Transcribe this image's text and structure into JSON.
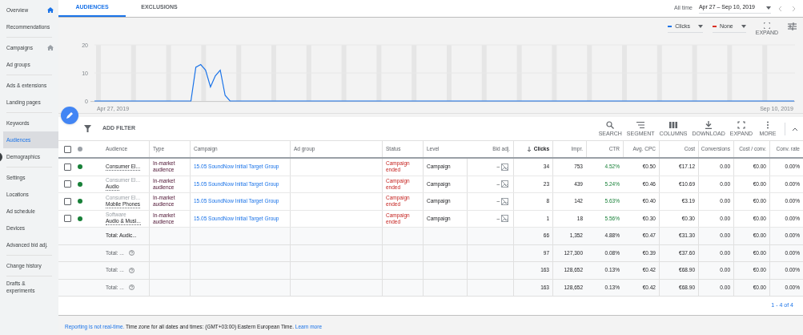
{
  "sidebar": {
    "sections": [
      [
        {
          "label": "Overview",
          "home": true,
          "selected": false
        },
        {
          "label": "Recommendations",
          "home": false,
          "selected": false
        }
      ],
      [
        {
          "label": "Campaigns",
          "home": true,
          "selected": false
        },
        {
          "label": "Ad groups",
          "home": false,
          "selected": false
        }
      ],
      [
        {
          "label": "Ads & extensions",
          "home": false,
          "selected": false
        },
        {
          "label": "Landing pages",
          "home": false,
          "selected": false
        }
      ],
      [
        {
          "label": "Keywords",
          "home": false,
          "selected": false
        },
        {
          "label": "Audiences",
          "home": false,
          "selected": true
        },
        {
          "label": "Demographics",
          "home": false,
          "selected": false
        }
      ],
      [
        {
          "label": "Settings",
          "home": false,
          "selected": false
        },
        {
          "label": "Locations",
          "home": false,
          "selected": false
        },
        {
          "label": "Ad schedule",
          "home": false,
          "selected": false
        },
        {
          "label": "Devices",
          "home": false,
          "selected": false
        },
        {
          "label": "Advanced bid adj.",
          "home": false,
          "selected": false
        }
      ],
      [
        {
          "label": "Change history",
          "home": false,
          "selected": false
        }
      ],
      [
        {
          "label": "Drafts & experiments",
          "home": false,
          "selected": false
        }
      ]
    ]
  },
  "tabs": [
    {
      "label": "AUDIENCES",
      "selected": true
    },
    {
      "label": "EXCLUSIONS",
      "selected": false
    }
  ],
  "date_range": {
    "preset": "All time",
    "value": "Apr 27 – Sep 10, 2019"
  },
  "chart": {
    "metrics": [
      {
        "label": "Clicks",
        "color": "#1a73e8"
      },
      {
        "label": "None",
        "color": "#d93025"
      }
    ],
    "expand_label": "EXPAND",
    "chart_data": {
      "type": "line",
      "categories": [
        "Apr 27, 2019",
        null,
        null,
        null,
        null,
        null,
        null,
        null,
        null,
        null,
        null,
        null,
        null,
        null,
        null,
        null,
        null,
        null,
        null,
        null,
        null,
        null,
        null,
        null,
        null,
        null,
        null,
        null,
        null,
        null,
        null,
        null,
        null,
        null,
        null,
        null,
        null,
        null,
        null,
        null,
        null,
        null,
        null,
        null,
        null,
        null,
        null,
        null,
        null,
        null,
        null,
        null,
        null,
        null,
        null,
        null,
        null,
        null,
        null,
        null,
        null,
        null,
        null,
        null,
        null,
        null,
        null,
        null,
        null,
        null,
        null,
        null,
        null,
        null,
        null,
        null,
        null,
        null,
        null,
        null,
        null,
        null,
        null,
        null,
        null,
        null,
        null,
        null,
        null,
        null,
        null,
        null,
        null,
        null,
        null,
        null,
        null,
        null,
        null,
        null,
        null,
        null,
        null,
        null,
        null,
        null,
        null,
        null,
        null,
        null,
        null,
        null,
        null,
        null,
        null,
        null,
        null,
        null,
        null,
        null,
        null,
        null,
        null,
        null,
        null,
        null,
        null,
        null,
        null,
        null,
        null,
        null,
        null,
        null,
        null,
        null,
        "Sep 10, 2019"
      ],
      "series": [
        {
          "color": "#1a73e8",
          "values": [
            0,
            0,
            0,
            0,
            0,
            0,
            0,
            0,
            0,
            0,
            0,
            0,
            0,
            0,
            0,
            0,
            0,
            12,
            13,
            11,
            5,
            9,
            11,
            2,
            0,
            0,
            0,
            0,
            0,
            0,
            0,
            0,
            0,
            0,
            0,
            0,
            0,
            0,
            0,
            0,
            0,
            0,
            0,
            0,
            0,
            0,
            0,
            0,
            0,
            0,
            0,
            0,
            0,
            0,
            0,
            0,
            0,
            0,
            0,
            0,
            0,
            0,
            0,
            0,
            0,
            0,
            0,
            0,
            0,
            0,
            0,
            0,
            0,
            0,
            0,
            0,
            0,
            0,
            0,
            0,
            0,
            0,
            0,
            0,
            0,
            0,
            0,
            0,
            0,
            0,
            0,
            0,
            0,
            0,
            0,
            0,
            0,
            0,
            0,
            0,
            0,
            0,
            0,
            0,
            0,
            0,
            0,
            0,
            0,
            0,
            0,
            0,
            0,
            0,
            0,
            0,
            0,
            0,
            0,
            0,
            0,
            0,
            0,
            0,
            0,
            0,
            0,
            0,
            0,
            0,
            0,
            0,
            0,
            0,
            0,
            0,
            0
          ]
        }
      ],
      "ylim": [
        0,
        20
      ],
      "yticks": [
        0,
        10,
        20
      ]
    }
  },
  "toolbar": {
    "filter_label": "ADD FILTER",
    "tools": [
      "SEARCH",
      "SEGMENT",
      "COLUMNS",
      "DOWNLOAD",
      "EXPAND",
      "MORE"
    ]
  },
  "table": {
    "select_all": {
      "checked": false
    },
    "columns": [
      "Audience",
      "Type",
      "Campaign",
      "Ad group",
      "Status",
      "Level",
      "Bid adj.",
      "Clicks",
      "Impr.",
      "CTR",
      "Avg. CPC",
      "Cost",
      "Conversions",
      "Cost / conv.",
      "Conv. rate"
    ],
    "rows": [
      {
        "checked": false,
        "enabled": true,
        "name": "Consumer El...",
        "type": "In-market audience",
        "campaign": "15.05 SoundNow Initial Target Group",
        "status": "Campaign ended",
        "level": "Campaign",
        "bid_adj": "–",
        "clicks": "34",
        "impr": "753",
        "ctr": "4.52%",
        "avg_cpc": "€0.50",
        "cost": "€17.12",
        "conversions": "0.00",
        "cost_conv": "€0.00",
        "conv_rate": "0.00%"
      },
      {
        "checked": false,
        "enabled": true,
        "category": "Consumer El...",
        "name": "Audio",
        "type": "In-market audience",
        "campaign": "15.05 SoundNow Initial Target Group",
        "status": "Campaign ended",
        "level": "Campaign",
        "bid_adj": "–",
        "clicks": "23",
        "impr": "439",
        "ctr": "5.24%",
        "avg_cpc": "€0.46",
        "cost": "€10.69",
        "conversions": "0.00",
        "cost_conv": "€0.00",
        "conv_rate": "0.00%"
      },
      {
        "checked": false,
        "enabled": true,
        "category": "Consumer El...",
        "name": "Mobile Phones",
        "type": "In-market audience",
        "campaign": "15.05 SoundNow Initial Target Group",
        "status": "Campaign ended",
        "level": "Campaign",
        "bid_adj": "–",
        "clicks": "8",
        "impr": "142",
        "ctr": "5.63%",
        "avg_cpc": "€0.40",
        "cost": "€3.19",
        "conversions": "0.00",
        "cost_conv": "€0.00",
        "conv_rate": "0.00%"
      },
      {
        "checked": false,
        "enabled": true,
        "category": "Software",
        "name": "Audio & Musi...",
        "type": "In-market audience",
        "campaign": "15.05 SoundNow Initial Target Group",
        "status": "Campaign ended",
        "level": "Campaign",
        "bid_adj": "–",
        "clicks": "1",
        "impr": "18",
        "ctr": "5.56%",
        "avg_cpc": "€0.30",
        "cost": "€0.30",
        "conversions": "0.00",
        "cost_conv": "€0.00",
        "conv_rate": "0.00%"
      }
    ],
    "totals": [
      {
        "label": "Total: Audic...",
        "help": false,
        "clicks": "66",
        "impr": "1,352",
        "ctr": "4.88%",
        "avg_cpc": "€0.47",
        "cost": "€31.30",
        "conversions": "0.00",
        "cost_conv": "€0.00",
        "conv_rate": "0.00%"
      },
      {
        "label": "Total: ...",
        "help": true,
        "clicks": "97",
        "impr": "127,300",
        "ctr": "0.08%",
        "avg_cpc": "€0.39",
        "cost": "€37.60",
        "conversions": "0.00",
        "cost_conv": "€0.00",
        "conv_rate": "0.00%"
      },
      {
        "label": "Total: ...",
        "help": true,
        "clicks": "163",
        "impr": "128,652",
        "ctr": "0.13%",
        "avg_cpc": "€0.42",
        "cost": "€68.90",
        "conversions": "0.00",
        "cost_conv": "€0.00",
        "conv_rate": "0.00%"
      },
      {
        "label": "Total: ...",
        "help": true,
        "clicks": "163",
        "impr": "128,652",
        "ctr": "0.13%",
        "avg_cpc": "€0.42",
        "cost": "€68.90",
        "conversions": "0.00",
        "cost_conv": "€0.00",
        "conv_rate": "0.00%"
      }
    ]
  },
  "pagination": "1 - 4 of 4",
  "footer": {
    "link": "Reporting is not real-time.",
    "text": "Time zone for all dates and times: (GMT+03:00) Eastern European Time.",
    "learn_more": "Learn more"
  }
}
